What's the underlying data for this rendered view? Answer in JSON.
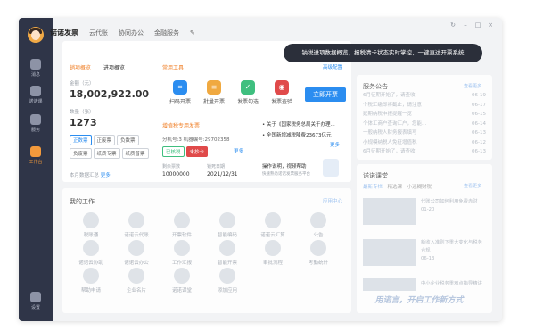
{
  "tabs": [
    "诺诺发票",
    "云代账",
    "协同办公",
    "金融服务"
  ],
  "sidebar": [
    "消息",
    "诺诺课",
    "服务",
    "工作台",
    "设置"
  ],
  "tooltip": "钠税进项数据概览，报税清卡状态实时掌控，一键直达开票系统",
  "summary": {
    "tab1": "销项概览",
    "tab2": "进项概览",
    "amount_label": "金额（元）",
    "amount": "18,002,922.00",
    "count_label": "数量（张）",
    "count": "1273",
    "tags": [
      "正数票",
      "正废票",
      "负数票",
      "负废票",
      "纸质专票",
      "纸质普票"
    ],
    "report": "本月数据汇总",
    "more": "更多"
  },
  "tools": {
    "title": "常用工具",
    "more": "高级配置",
    "items": [
      "扫码开票",
      "批量开票",
      "发票勾选",
      "发票查验"
    ],
    "button": "立即开票"
  },
  "tax": {
    "title": "增值税专用发票",
    "info": "分机号:3 机器编号:29702358",
    "badge1": "已核税",
    "badge2": "未抄卡",
    "remain_label": "剩余票数",
    "remain": "10000000",
    "date_label": "锁死日期",
    "date": "2021/12/31",
    "more": "更多"
  },
  "notice": {
    "items": [
      "关于《国家税务总局关于办理...",
      "全国新增减税降费23673亿元"
    ],
    "more": "更多",
    "help": "操作说明，视频帮助",
    "help_sub": "快速熟悉诺诺发票服务平台"
  },
  "work": {
    "title": "我的工作",
    "more": "应用中心",
    "items": [
      "税账通",
      "诺诺云代账",
      "开票软件",
      "智能编码",
      "诺诺云汇算",
      "公告",
      "诺诺云协助",
      "诺诺云办公",
      "工作汇报",
      "智能开票",
      "审批流程",
      "考勤统计",
      "帮助申请",
      "企业名片",
      "诺诺课堂",
      "添加应用"
    ]
  },
  "service": {
    "title": "服务公告",
    "more": "查看更多",
    "items": [
      [
        "6月征期开始了，请查收",
        "06-19"
      ],
      [
        "个税汇缴即将截止，请注意",
        "06-17"
      ],
      [
        "延期纳税申报提醒一览",
        "06-15"
      ],
      [
        "个体工商户查询汇户，您能...",
        "06-14"
      ],
      [
        "一般纳税人财务报表填写",
        "06-13"
      ],
      [
        "小规模纳税人免征增值税",
        "06-12"
      ],
      [
        "6月征期开始了，请查收",
        "06-13"
      ]
    ]
  },
  "course": {
    "title": "诺诺课堂",
    "tabs": [
      "最新专栏",
      "精选课",
      "小迷糊财税"
    ],
    "more": "查看更多",
    "items": [
      [
        "代账公司如何利用免费赤财",
        "01-20"
      ],
      [
        "新收入准则下重大变化与税务合规",
        "06-13"
      ],
      [
        "中小企业税务重难点指导精讲",
        "01-09"
      ]
    ],
    "banner": "用诺言，开启工作新方式"
  },
  "colors": {
    "accent": "#2b8df0",
    "orange": "#f0832d",
    "sidebar": "#2f3548"
  }
}
